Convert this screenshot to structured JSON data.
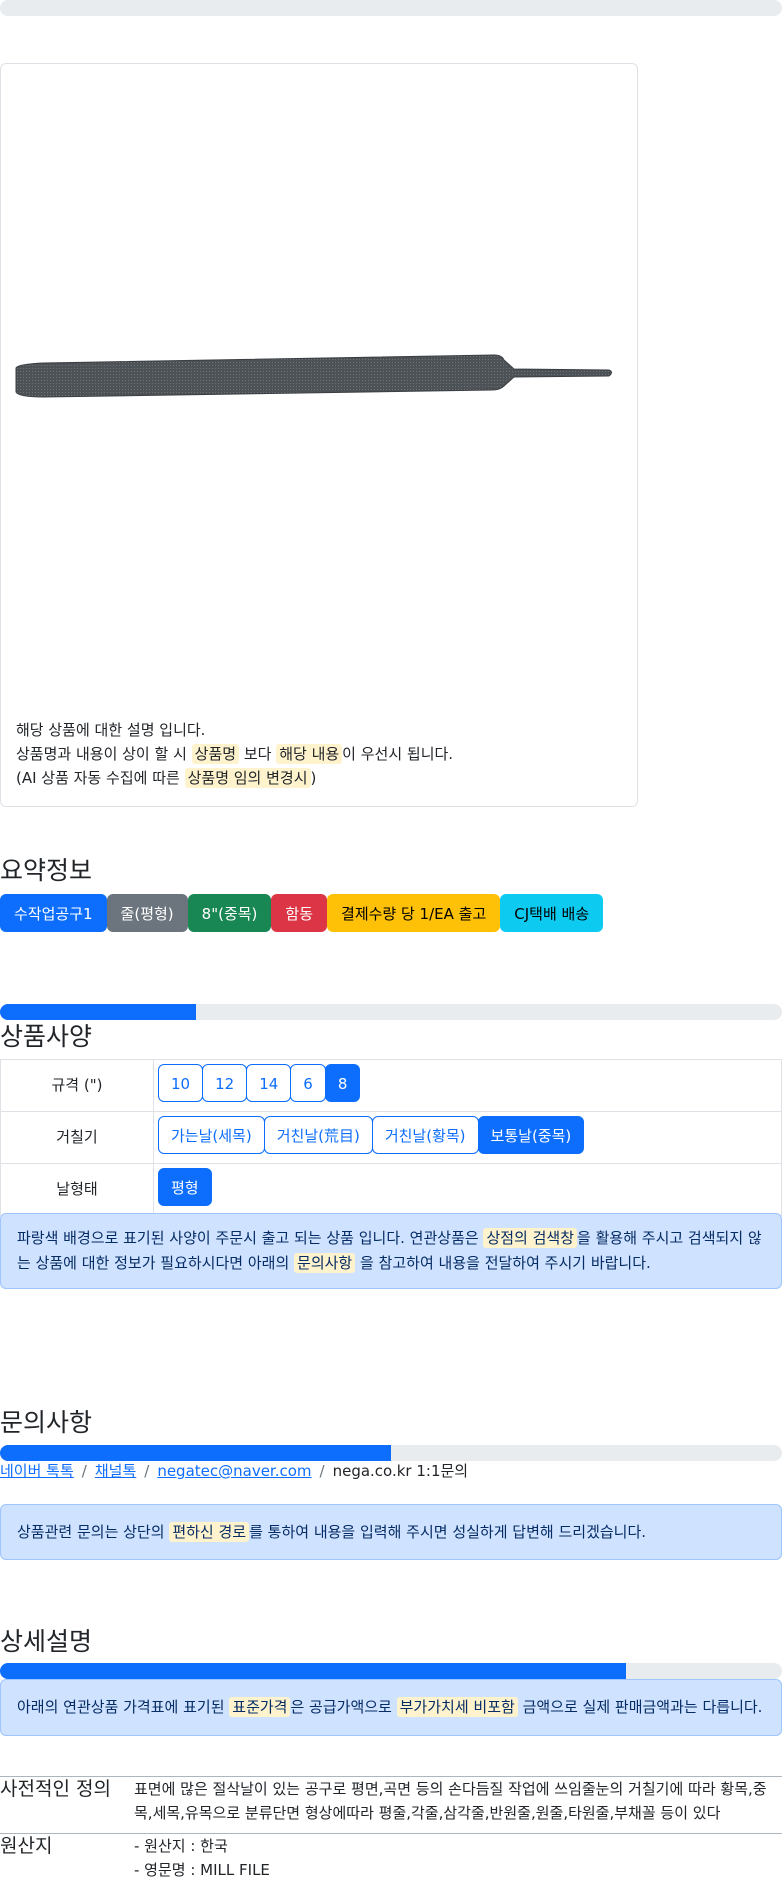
{
  "product_image": {
    "description_lines": [
      "해당 상품에 대한 설명 입니다.",
      {
        "pre": "상품명과 내용이 상이 할 시 ",
        "hl1": "상품명",
        "mid": " 보다 ",
        "hl2": "해당 내용",
        "post": "이 우선시 됩니다."
      },
      {
        "pre": "(AI 상품 자동 수집에 따른 ",
        "hl": "상품명 임의 변경시",
        "post": ")"
      }
    ]
  },
  "summary": {
    "title": "요약정보",
    "badges": [
      "수작업공구1",
      "줄(평형)",
      "8\"(중목)",
      "함동",
      "결제수량 당 1/EA 출고",
      "CJ택배 배송"
    ]
  },
  "spec": {
    "progress": 0.25,
    "title": "상품사양",
    "rows": [
      {
        "label": "규격 (\")",
        "options": [
          "10",
          "12",
          "14",
          "6",
          "8"
        ],
        "selected": "8"
      },
      {
        "label": "거칠기",
        "options": [
          "가는날(세목)",
          "거친날(荒目)",
          "거친날(황목)",
          "보통날(중목)"
        ],
        "selected": "보통날(중목)"
      },
      {
        "label": "날형태",
        "options": [
          "평형"
        ],
        "selected": "평형"
      }
    ],
    "notice": {
      "pre": "파랑색 배경으로 표기된 사양이 주문시 출고 되는 상품 입니다. 연관상품은 ",
      "hl1": "상점의 검색창",
      "mid": "을 활용해 주시고 검색되지 않는 상품에 대한 정보가 필요하시다면 아래의 ",
      "hl2": "문의사항",
      "post": " 을 참고하여 내용을 전달하여 주시기 바랍니다."
    }
  },
  "inquiry": {
    "progress": 0.5,
    "title": "문의사항",
    "links": [
      "네이버 톡톡",
      "채널톡",
      "negatec@naver.com"
    ],
    "plain": "nega.co.kr 1:1문의",
    "notice": {
      "pre": "상품관련 문의는 상단의 ",
      "hl": "편하신 경로",
      "post": "를 통하여 내용을 입력해 주시면 성실하게 답변해 드리겠습니다."
    }
  },
  "detail": {
    "progress": 0.8,
    "title": "상세설명",
    "notice": {
      "pre": "아래의 연관상품 가격표에 표기된 ",
      "hl1": "표준가격",
      "mid": "은 공급가액으로 ",
      "hl2": "부가가치세 비포함",
      "post": " 금액으로 실제 판매금액과는 다릅니다."
    },
    "rows": [
      {
        "key": "사전적인 정의",
        "value": "표면에 많은 절삭날이 있는 공구로 평면,곡면 등의 손다듬질 작업에 쓰임줄눈의 거칠기에 따라 황목,중목,세목,유목으로 분류단면 형상에따라 평줄,각줄,삼각줄,반원줄,원줄,타원줄,부채꼴 등이 있다"
      },
      {
        "key": "원산지",
        "value_lines": [
          "- 원산지 : 한국",
          "- 영문명 : MILL FILE"
        ]
      }
    ]
  },
  "colors": {
    "primary": "#0d6efd",
    "alert_bg": "#cfe2ff",
    "highlight": "#fff3cd"
  }
}
